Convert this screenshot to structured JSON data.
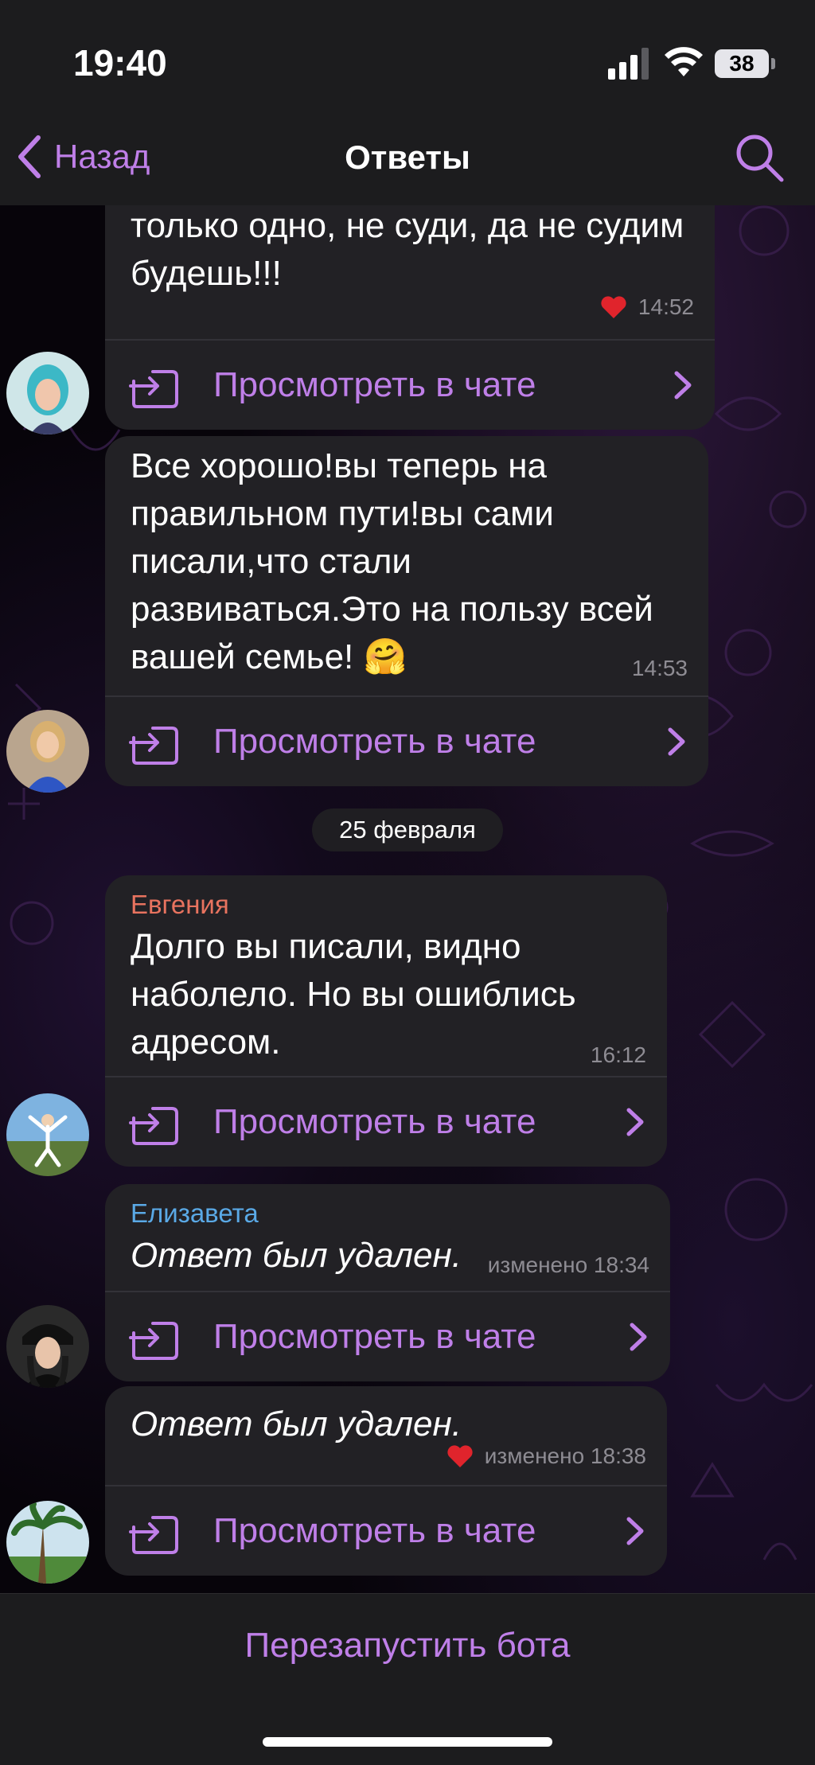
{
  "status_bar": {
    "time": "19:40",
    "battery": "38"
  },
  "nav": {
    "back_label": "Назад",
    "title": "Ответы"
  },
  "messages": [
    {
      "sender": "",
      "text": "душой. А Марии можно сказать только одно, не суди, да не судим будешь!!!",
      "time": "14:52",
      "reaction": "heart",
      "view_label": "Просмотреть в чате"
    },
    {
      "sender": "",
      "text": "Все хорошо!вы теперь на правильном пути!вы сами писали,что стали развиваться.Это на пользу всей вашей семье! 🤗",
      "time": "14:53",
      "view_label": "Просмотреть в чате"
    },
    {
      "sender": "Евгения",
      "sender_color": "#e8735f",
      "text": "Долго вы писали, видно наболело. Но вы ошиблись адресом.",
      "time": "16:12",
      "view_label": "Просмотреть в чате"
    },
    {
      "sender": "Елизавета",
      "sender_color": "#5aa9e6",
      "text": "Ответ был удален.",
      "time": "изменено 18:34",
      "view_label": "Просмотреть в чате"
    },
    {
      "sender": "",
      "text": "Ответ был удален.",
      "time": "изменено 18:38",
      "reaction": "heart",
      "view_label": "Просмотреть в чате"
    }
  ],
  "date_separator": "25 февраля",
  "bottom": {
    "restart_label": "Перезапустить бота"
  },
  "colors": {
    "accent": "#bf7fe8",
    "bubble": "#222125",
    "bar": "#1c1c1e"
  },
  "icons": [
    "back-chevron-icon",
    "search-icon",
    "forward-to-chat-icon",
    "chevron-right-icon",
    "heart-icon",
    "signal-icon",
    "wifi-icon",
    "battery-icon"
  ]
}
